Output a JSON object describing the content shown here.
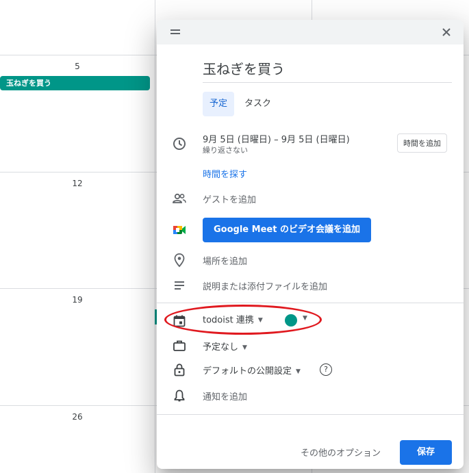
{
  "calendar": {
    "day_numbers": [
      "5",
      "12",
      "19",
      "26"
    ],
    "event_chip_label": "玉ねぎを買う"
  },
  "dialog": {
    "title_value": "玉ねぎを買う",
    "tabs": [
      {
        "label": "予定",
        "active": true
      },
      {
        "label": "タスク",
        "active": false
      }
    ],
    "date_range": "9月 5日 (日曜日)   –   9月 5日 (日曜日)",
    "repeat_text": "繰り返さない",
    "add_time_label": "時間を追加",
    "find_time_label": "時間を探す",
    "guests_placeholder": "ゲストを追加",
    "meet_button_label": "Google Meet のビデオ会議を追加",
    "location_placeholder": "場所を追加",
    "description_placeholder": "説明または添付ファイルを追加",
    "calendar_name": "todoist 連携",
    "calendar_color": "#009688",
    "busy_status": "予定なし",
    "visibility": "デフォルトの公開設定",
    "notification_placeholder": "通知を追加",
    "more_options_label": "その他のオプション",
    "save_label": "保存"
  },
  "colors": {
    "accent": "#1a73e8",
    "event": "#009688",
    "highlight_oval": "#e0191f"
  }
}
